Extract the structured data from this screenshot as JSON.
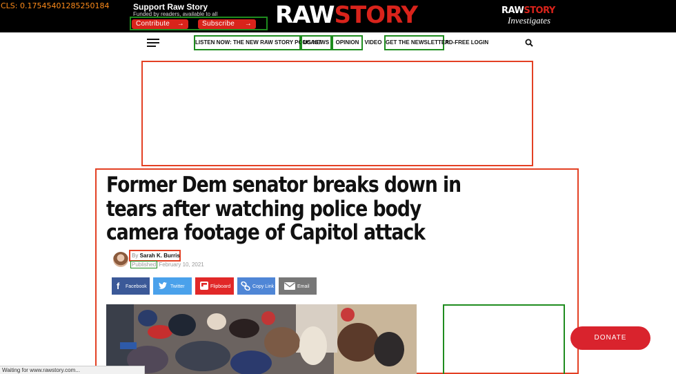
{
  "debug": {
    "cls_text": "CLS: 0.17545401285250184"
  },
  "support": {
    "title": "Support Raw Story",
    "subtitle": "Funded by readers, available to all",
    "contribute_label": "Contribute",
    "subscribe_label": "Subscribe",
    "arrow": "→"
  },
  "brand": {
    "logo_raw": "RAW",
    "logo_story": "STORY",
    "investigates_raw": "RAW",
    "investigates_story": "STORY",
    "investigates_word": "Investigates",
    "accent": "#d9231b"
  },
  "nav": {
    "items": [
      {
        "label": "LISTEN NOW: THE NEW RAW STORY PODCAST"
      },
      {
        "label": "US NEWS"
      },
      {
        "label": "OPINION"
      },
      {
        "label": "VIDEO"
      },
      {
        "label": "GET THE NEWSLETTER"
      },
      {
        "label": "AD-FREE LOGIN"
      }
    ]
  },
  "article": {
    "headline": "Former Dem senator breaks down in tears after watching police body camera footage of Capitol attack",
    "by": "By",
    "author": "Sarah K. Burris",
    "published_label": "Published",
    "date": "February 10, 2021"
  },
  "share": {
    "facebook": "Facebook",
    "twitter": "Twitter",
    "flipboard": "Flipboard",
    "copy": "Copy Link",
    "email": "Email"
  },
  "donate_label": "DONATE",
  "status_text": "Waiting for www.rawstory.com..."
}
